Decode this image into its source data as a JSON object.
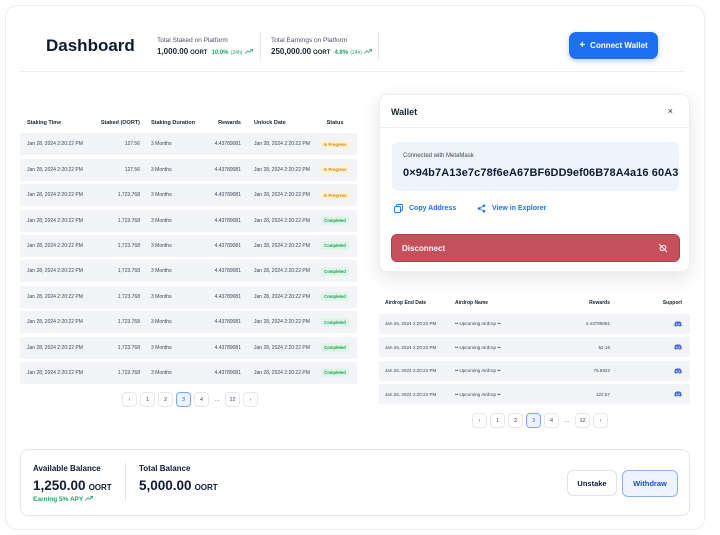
{
  "header": {
    "title": "Dashboard",
    "stats": [
      {
        "label": "Total Staked on Platform",
        "value": "1,000.00",
        "unit": "OORT",
        "change": "10.0%",
        "period": "(24h)"
      },
      {
        "label": "Total Earnings on Platform",
        "value": "250,000.00",
        "unit": "OORT",
        "change": "4.8%",
        "period": "(24h)"
      }
    ],
    "connect_label": "Connect Wallet"
  },
  "staking": {
    "columns": [
      "Staking Time",
      "Staked (OORT)",
      "Staking Duration",
      "Rewards",
      "Unlock Date",
      "Status"
    ],
    "rows": [
      [
        "Jan 28, 2024 2:20:22 PM",
        "127.56",
        "3 Months",
        "4.43789081",
        "Jan 28, 2024 2:20:22 PM",
        "In Progress"
      ],
      [
        "Jan 28, 2024 2:20:22 PM",
        "127.56",
        "3 Months",
        "4.43789081",
        "Jan 28, 2024 2:20:22 PM",
        "In Progress"
      ],
      [
        "Jan 28, 2024 2:20:22 PM",
        "1,723.768",
        "3 Months",
        "4.43789081",
        "Jan 28, 2024 2:20:22 PM",
        "In Progress"
      ],
      [
        "Jan 28, 2024 2:20:22 PM",
        "1,723.768",
        "3 Months",
        "4.43789081",
        "Jan 28, 2024 2:20:22 PM",
        "Completed"
      ],
      [
        "Jan 28, 2024 2:20:22 PM",
        "1,723.768",
        "3 Months",
        "4.43789081",
        "Jan 28, 2024 2:20:22 PM",
        "Completed"
      ],
      [
        "Jan 28, 2024 2:20:22 PM",
        "1,723.768",
        "3 Months",
        "4.43789081",
        "Jan 28, 2024 2:20:22 PM",
        "Completed"
      ],
      [
        "Jan 28, 2024 2:20:22 PM",
        "1,723.768",
        "3 Months",
        "4.43789081",
        "Jan 28, 2024 2:20:22 PM",
        "Completed"
      ],
      [
        "Jan 28, 2024 2:20:22 PM",
        "1,723.768",
        "3 Months",
        "4.43789081",
        "Jan 28, 2024 2:20:22 PM",
        "Completed"
      ],
      [
        "Jan 28, 2024 2:20:22 PM",
        "1,723.768",
        "3 Months",
        "4.43789081",
        "Jan 28, 2024 2:20:22 PM",
        "Completed"
      ],
      [
        "Jan 28, 2024 2:20:22 PM",
        "1,723.768",
        "3 Months",
        "4.43789081",
        "Jan 28, 2024 2:20:22 PM",
        "Completed"
      ]
    ],
    "pager": [
      "‹",
      "1",
      "2",
      "3",
      "4",
      "...",
      "12",
      "›"
    ],
    "active_page": "3"
  },
  "wallet": {
    "title": "Wallet",
    "close": "×",
    "connected_with": "Connected with MetaMask",
    "address": "0×94b7A13e7c78f6eA67BF6DD9ef06B78A4a16 60A3",
    "copy_label": "Copy Address",
    "explorer_label": "View in Explorer",
    "disconnect_label": "Disconnect"
  },
  "airdrop": {
    "columns": [
      "Airdrop End Date",
      "Airdrop Name",
      "Rewards",
      "Support"
    ],
    "rows": [
      [
        "Jan 26, 2024 2:20:22 PM",
        "•• Upcoming Airdrop ••",
        "4.43789081"
      ],
      [
        "Jan 26, 2024 2:20:22 PM",
        "•• Upcoming Airdrop ••",
        "52.16"
      ],
      [
        "Jan 26, 2024 2:20:22 PM",
        "•• Upcoming Airdrop ••",
        "75.5922"
      ],
      [
        "Jan 26, 2024 2:20:22 PM",
        "•• Upcoming Airdrop ••",
        "122.57"
      ]
    ],
    "pager": [
      "‹",
      "1",
      "2",
      "3",
      "4",
      "...",
      "12",
      "›"
    ],
    "active_page": "3"
  },
  "balance": {
    "available_label": "Available Balance",
    "available_value": "1,250.00",
    "available_unit": "OORT",
    "earning": "Earning 5% APY",
    "total_label": "Total Balance",
    "total_value": "5,000.00",
    "total_unit": "OORT",
    "unstake_label": "Unstake",
    "withdraw_label": "Withdraw"
  },
  "colors": {
    "primary": "#1f6ff2",
    "success": "#22a36a",
    "danger": "#c64f5c",
    "warning": "#c9880e"
  }
}
